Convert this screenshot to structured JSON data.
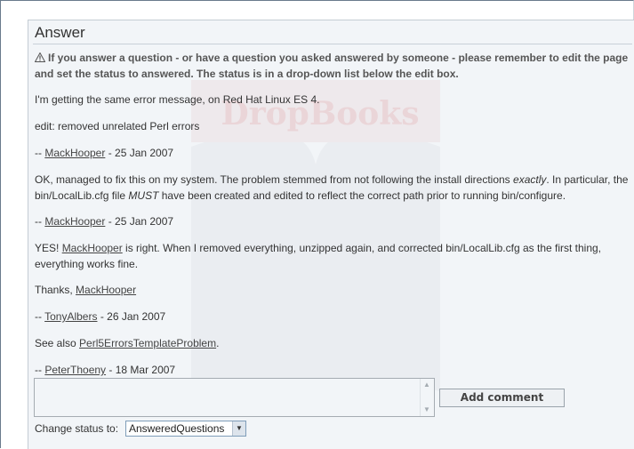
{
  "section": {
    "title": "Answer",
    "notice": "If you answer a question - or have a question you asked answered by someone - please remember to edit the page and set the status to answered. The status is in a drop-down list below the edit box."
  },
  "posts": [
    {
      "text": "I'm getting the same error message, on Red Hat Linux ES 4."
    },
    {
      "text": "edit: removed unrelated Perl errors"
    },
    {
      "sig_prefix": "-- ",
      "author": "MackHooper",
      "date": " - 25 Jan 2007"
    },
    {
      "text_part1": "OK, managed to fix this on my system. The problem stemmed from not following the install directions ",
      "em1": "exactly",
      "text_part2": ". In particular, the bin/LocalLib.cfg file ",
      "em2": "MUST",
      "text_part3": " have been created and edited to reflect the correct path prior to running bin/configure."
    },
    {
      "sig_prefix": "-- ",
      "author": "MackHooper",
      "date": " - 25 Jan 2007"
    },
    {
      "text_prefix": "YES! ",
      "link": "MackHooper",
      "text_suffix": " is right. When I removed everything, unzipped again, and corrected bin/LocalLib.cfg as the first thing, everything works fine."
    },
    {
      "text_prefix": "Thanks, ",
      "link": "MackHooper"
    },
    {
      "sig_prefix": "-- ",
      "author": "TonyAlbers",
      "date": " - 26 Jan 2007"
    },
    {
      "text_prefix": "See also ",
      "link": "Perl5ErrorsTemplateProblem",
      "text_suffix": "."
    },
    {
      "sig_prefix": "-- ",
      "author": "PeterThoeny",
      "date": " - 18 Mar 2007"
    }
  ],
  "comment_form": {
    "textarea_value": "",
    "add_button_label": "Add comment",
    "status_label": "Change status to:",
    "status_selected": "AnsweredQuestions"
  },
  "watermark": {
    "text": "DropBooks"
  },
  "colors": {
    "panel_bg": "#f2f5f8",
    "link": "#444444",
    "watermark": "#d9a1a6"
  }
}
